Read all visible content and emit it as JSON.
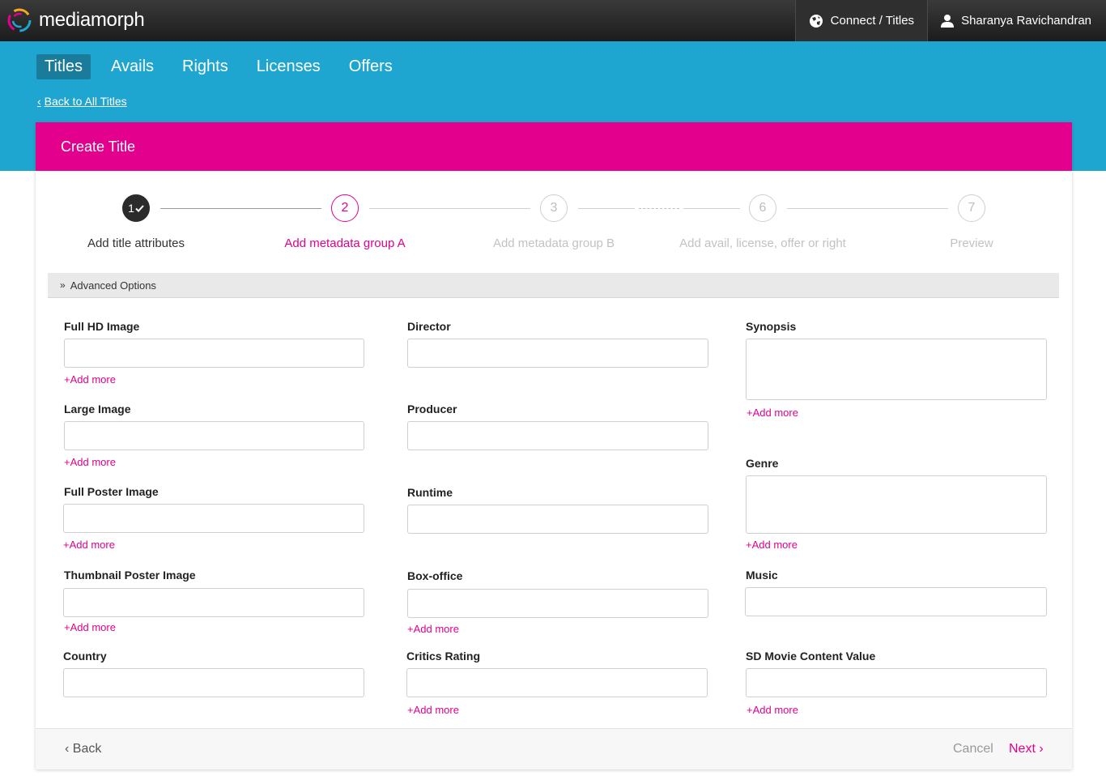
{
  "app": {
    "name": "mediamorph"
  },
  "topbar": {
    "connect_label": "Connect / Titles",
    "user_name": "Sharanya Ravichandran"
  },
  "nav": {
    "items": [
      "Titles",
      "Avails",
      "Rights",
      "Licenses",
      "Offers"
    ],
    "active": "Titles"
  },
  "back_link": "Back to All Titles",
  "card": {
    "title": "Create Title"
  },
  "stepper": {
    "steps": [
      {
        "number": "1",
        "label": "Add title attributes",
        "state": "done"
      },
      {
        "number": "2",
        "label": "Add metadata group A",
        "state": "current"
      },
      {
        "number": "3",
        "label": "Add metadata group B",
        "state": "upcoming"
      },
      {
        "number": "6",
        "label": "Add avail, license, offer or right",
        "state": "upcoming"
      },
      {
        "number": "7",
        "label": "Preview",
        "state": "upcoming"
      }
    ]
  },
  "advanced_options": "Advanced Options",
  "add_more": "+Add more",
  "fields": {
    "full_hd_image": "Full HD Image",
    "large_image": "Large Image",
    "full_poster_image": "Full Poster Image",
    "thumbnail_poster_image": "Thumbnail Poster Image",
    "country": "Country",
    "director": "Director",
    "producer": "Producer",
    "runtime": "Runtime",
    "box_office": "Box-office",
    "critics_rating": "Critics Rating",
    "synopsis": "Synopsis",
    "genre": "Genre",
    "music": "Music",
    "sd_movie_content_value": "SD Movie Content Value"
  },
  "footer": {
    "back": "Back",
    "cancel": "Cancel",
    "next": "Next"
  },
  "colors": {
    "brand_pink": "#e3008c",
    "nav_blue": "#1fa6d0",
    "topbar_dark": "#2a2a2a"
  },
  "icons": {
    "logo": "mediamorph-logo-icon",
    "connect": "globe-icon",
    "user": "user-icon",
    "step_done": "check-icon"
  }
}
